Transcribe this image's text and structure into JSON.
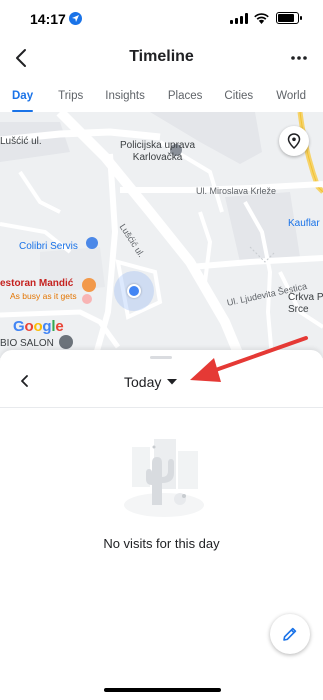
{
  "status_bar": {
    "time": "14:17"
  },
  "header": {
    "title": "Timeline"
  },
  "tabs": [
    {
      "label": "Day",
      "active": true
    },
    {
      "label": "Trips",
      "active": false
    },
    {
      "label": "Insights",
      "active": false
    },
    {
      "label": "Places",
      "active": false
    },
    {
      "label": "Cities",
      "active": false
    },
    {
      "label": "World",
      "active": false
    }
  ],
  "map": {
    "labels": {
      "lusic_top": "Lušćić ul.",
      "police": "Policijska uprava\nKarlovačka",
      "miroslava": "Ul. Miroslava Krleže",
      "lusic_road": "Lušćić ul.",
      "colibri": "Colibri Servis",
      "restaurant": "estoran Mandić",
      "busy": "As busy as it gets",
      "ljudevita": "Ul. Ljudevita Šestica",
      "kaufland": "Kauflar",
      "crkva": "Crkva P\nSrce",
      "bio_salon": "BIO SALON",
      "google": "Google"
    }
  },
  "sheet": {
    "date_label": "Today",
    "empty_message": "No visits for this day"
  },
  "colors": {
    "accent": "#1a73e8",
    "annotation": "#e53935",
    "map_bg": "#eef0f2"
  },
  "icons": {
    "back": "chevron-left-icon",
    "more": "more-horizontal-icon",
    "pin": "map-pin-icon",
    "prev": "chevron-left-icon",
    "dropdown": "caret-down-icon",
    "edit": "pencil-icon"
  }
}
